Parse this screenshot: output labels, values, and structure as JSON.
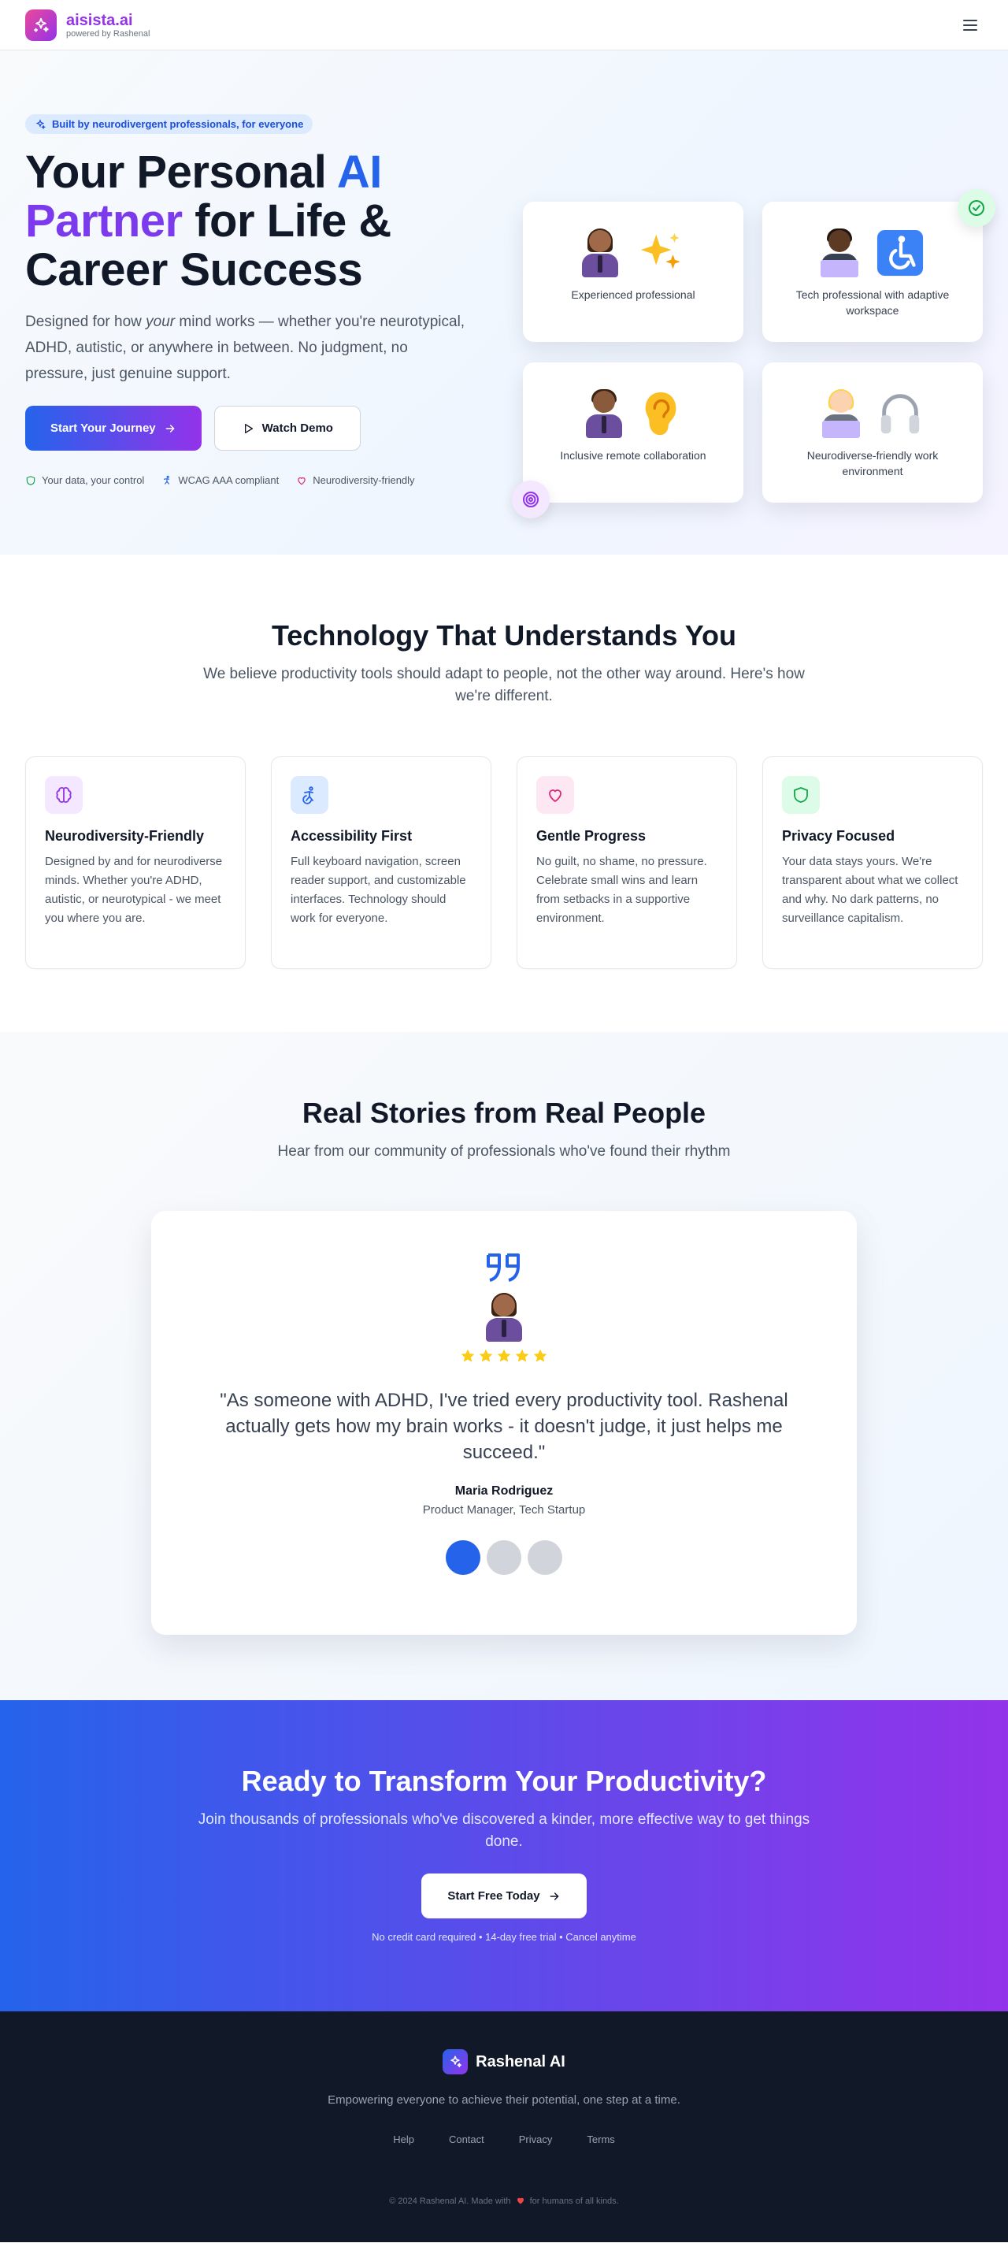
{
  "header": {
    "brand_name": "aisista.ai",
    "brand_sub": "powered by Rashenal"
  },
  "hero": {
    "badge": "Built by neurodivergent professionals, for everyone",
    "title_line1_a": "Your Personal ",
    "title_line1_b": "AI",
    "title_line2_a": "Partner",
    "title_line2_b": " for Life &",
    "title_line3": "Career Success",
    "desc_a": "Designed for how ",
    "desc_em": "your",
    "desc_b": " mind works — whether you're neurotypical, ADHD, autistic, or anywhere in between. No judgment, no pressure, just genuine support.",
    "primary_button": "Start Your Journey",
    "secondary_button": "Watch Demo",
    "trust": [
      "Your data, your control",
      "WCAG AAA compliant",
      "Neurodiversity-friendly"
    ],
    "cards": [
      {
        "label": "Experienced professional"
      },
      {
        "label": "Tech professional with adaptive workspace"
      },
      {
        "label": "Inclusive remote collaboration"
      },
      {
        "label": "Neurodiverse-friendly work environment"
      }
    ]
  },
  "tech": {
    "title": "Technology That Understands You",
    "subtitle": "We believe productivity tools should adapt to people, not the other way around. Here's how we're different.",
    "features": [
      {
        "title": "Neurodiversity-Friendly",
        "desc": "Designed by and for neurodiverse minds. Whether you're ADHD, autistic, or neurotypical - we meet you where you are.",
        "color": "#9333ea",
        "bg": "#f3e8ff",
        "icon": "brain-icon"
      },
      {
        "title": "Accessibility First",
        "desc": "Full keyboard navigation, screen reader support, and customizable interfaces. Technology should work for everyone.",
        "color": "#2563eb",
        "bg": "#dbeafe",
        "icon": "accessibility-icon"
      },
      {
        "title": "Gentle Progress",
        "desc": "No guilt, no shame, no pressure. Celebrate small wins and learn from setbacks in a supportive environment.",
        "color": "#db2777",
        "bg": "#fce7f3",
        "icon": "heart-icon"
      },
      {
        "title": "Privacy Focused",
        "desc": "Your data stays yours. We're transparent about what we collect and why. No dark patterns, no surveillance capitalism.",
        "color": "#16a34a",
        "bg": "#dcfce7",
        "icon": "shield-icon"
      }
    ]
  },
  "stories": {
    "title": "Real Stories from Real People",
    "subtitle": "Hear from our community of professionals who've found their rhythm",
    "rating": 5,
    "quote": "\"As someone with ADHD, I've tried every productivity tool. Rashenal actually gets how my brain works - it doesn't judge, it just helps me succeed.\"",
    "author": "Maria Rodriguez",
    "role": "Product Manager, Tech Startup",
    "active_slide": 1,
    "slide_count": 3
  },
  "cta": {
    "title": "Ready to Transform Your Productivity?",
    "subtitle": "Join thousands of professionals who've discovered a kinder, more effective way to get things done.",
    "button": "Start Free Today",
    "note": "No credit card required • 14-day free trial • Cancel anytime"
  },
  "footer": {
    "brand_name": "Rashenal AI",
    "tagline": "Empowering everyone to achieve their potential, one step at a time.",
    "links": [
      "Help",
      "Contact",
      "Privacy",
      "Terms"
    ],
    "copy_a": "© 2024 Rashenal AI. Made with",
    "copy_b": "for humans of all kinds."
  },
  "colors": {
    "primary_blue": "#2563eb",
    "primary_purple": "#9333ea",
    "brand_pink": "#ec4899",
    "dark": "#111827"
  }
}
